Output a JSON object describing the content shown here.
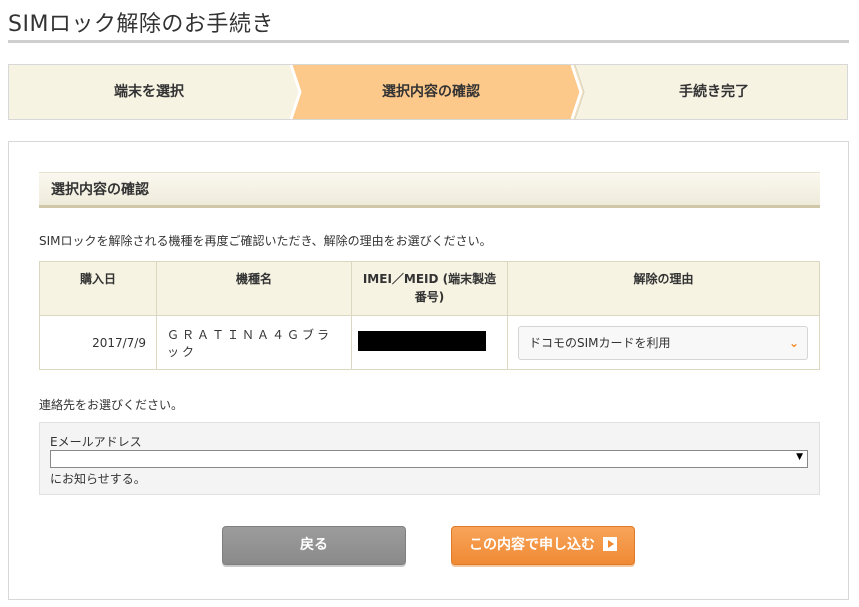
{
  "page": {
    "title": "SIMロック解除のお手続き"
  },
  "steps": [
    {
      "label": "端末を選択",
      "active": false
    },
    {
      "label": "選択内容の確認",
      "active": true
    },
    {
      "label": "手続き完了",
      "active": false
    }
  ],
  "section": {
    "heading": "選択内容の確認",
    "instruction": "SIMロックを解除される機種を再度ご確認いただき、解除の理由をお選びください。"
  },
  "table": {
    "headers": [
      "購入日",
      "機種名",
      "IMEI／MEID (端末製造番号)",
      "解除の理由"
    ],
    "row": {
      "purchase_date": "2017/7/9",
      "model": "ＧＲＡＴＩＮＡ４Ｇブラック",
      "reason_selected": "ドコモのSIMカードを利用"
    }
  },
  "contact": {
    "instruction": "連絡先をお選びください。",
    "label": "Eメールアドレス",
    "selected": "",
    "note": "にお知らせする。"
  },
  "buttons": {
    "back": "戻る",
    "submit": "この内容で申し込む"
  },
  "colors": {
    "active_step": "#fdc98a",
    "inactive_step": "#f6f3e3",
    "submit": "#f08a34",
    "back": "#939393"
  }
}
